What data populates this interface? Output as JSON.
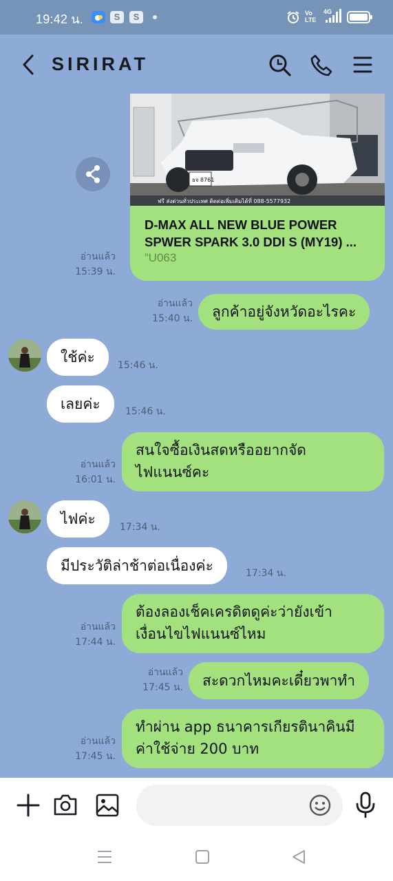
{
  "status_bar": {
    "time": "19:42 น.",
    "icons": [
      "weather-icon",
      "s-app-icon",
      "s-app-icon",
      "dot",
      "alarm-icon",
      "volte-icon",
      "4g-signal-icon",
      "battery-icon"
    ],
    "s_label": "S",
    "volte_label": "Vo LTE",
    "net_label": "4G"
  },
  "header": {
    "title": "SIRIRAT",
    "back_icon": "chevron-left-icon",
    "search_icon": "search-icon",
    "call_icon": "phone-icon",
    "menu_icon": "menu-icon"
  },
  "messages": [
    {
      "id": "m1",
      "type": "sent-card",
      "title": "D-MAX ALL NEW BLUE POWER SPWER SPARK 3.0 DDI S (MY19) ...",
      "subtitle": "”U063",
      "read": "อ่านแล้ว",
      "time": "15:39 น.",
      "image_plate": "ยจ 8761",
      "image_banner": "ฟรี ส่งด่วนทั่วประเทศ ติดต่อเพิ่มเติมได้ที่ 088-5577932"
    },
    {
      "id": "m2",
      "type": "sent",
      "text": "ลูกค้าอยู่จังหวัดอะไรคะ",
      "read": "อ่านแล้ว",
      "time": "15:40 น."
    },
    {
      "id": "m3",
      "type": "received",
      "text": "ใช้ค่ะ",
      "time": "15:46 น."
    },
    {
      "id": "m4",
      "type": "received",
      "text": "เลยค่ะ",
      "time": "15:46 น."
    },
    {
      "id": "m5",
      "type": "sent",
      "lines": [
        "สนใจซื้อเงินสดหรืออยากจัด",
        "ไฟแนนซ์คะ"
      ],
      "read": "อ่านแล้ว",
      "time": "16:01 น."
    },
    {
      "id": "m6",
      "type": "received",
      "text": "ไฟค่ะ",
      "time": "17:34 น."
    },
    {
      "id": "m7",
      "type": "received",
      "text": "มีประวัติล่าช้าต่อเนื่องค่ะ",
      "time": "17:34 น."
    },
    {
      "id": "m8",
      "type": "sent",
      "lines": [
        "ต้องลองเช็คเครดิตดูค่ะว่ายังเข้า",
        "เงื่อนไขไฟแนนซ์ไหม"
      ],
      "read": "อ่านแล้ว",
      "time": "17:44 น."
    },
    {
      "id": "m9",
      "type": "sent",
      "text": "สะดวกไหมคะเดี๋ยวพาทำ",
      "read": "อ่านแล้ว",
      "time": "17:45 น."
    },
    {
      "id": "m10",
      "type": "sent",
      "lines": [
        "ทำผ่าน app ธนาคารเกียรตินาคินมี",
        "ค่าใช้จ่าย 200 บาท"
      ],
      "read": "อ่านแล้ว",
      "time": "17:45 น."
    }
  ],
  "input_bar": {
    "add_icon": "plus-icon",
    "camera_icon": "camera-icon",
    "gallery_icon": "image-icon",
    "placeholder": "",
    "emoji_icon": "emoji-icon",
    "mic_icon": "microphone-icon"
  },
  "nav_bar": {
    "icons": [
      "recent-apps-icon",
      "home-icon",
      "back-icon"
    ]
  },
  "colors": {
    "background": "#8eabd8",
    "status_bar": "#7693b8",
    "sent_bubble": "#a3e17f",
    "received_bubble": "#ffffff",
    "meta_text": "#4d5b75"
  }
}
